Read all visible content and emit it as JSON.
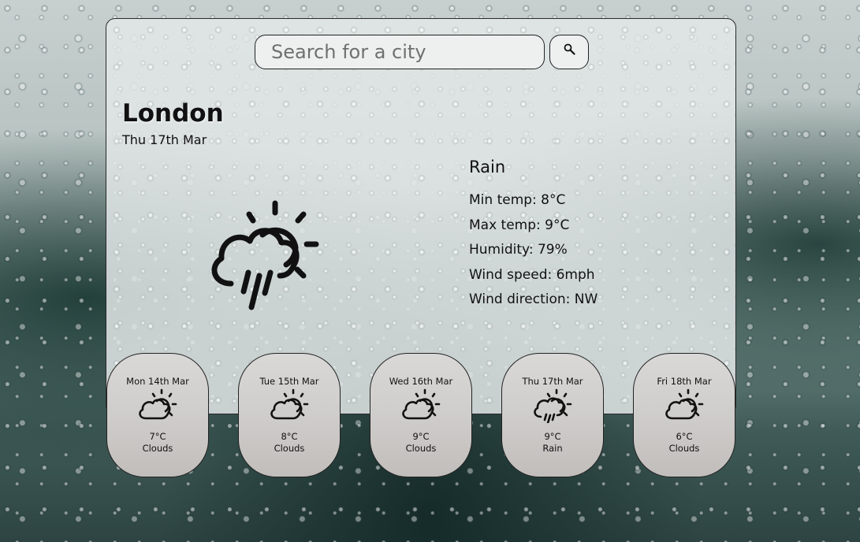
{
  "search": {
    "placeholder": "Search for a city",
    "button_icon": "search-icon"
  },
  "current": {
    "city": "London",
    "date": "Thu 17th Mar",
    "icon": "cloud-sun-rain-icon",
    "condition": "Rain",
    "min_temp": "Min temp: 8°C",
    "max_temp": "Max temp: 9°C",
    "humidity": "Humidity: 79%",
    "wind_speed": "Wind speed: 6mph",
    "wind_direction": "Wind direction: NW"
  },
  "forecast": [
    {
      "day": "Mon 14th Mar",
      "temp": "7°C",
      "desc": "Clouds",
      "icon": "cloud-sun-icon"
    },
    {
      "day": "Tue 15th Mar",
      "temp": "8°C",
      "desc": "Clouds",
      "icon": "cloud-sun-icon"
    },
    {
      "day": "Wed 16th Mar",
      "temp": "9°C",
      "desc": "Clouds",
      "icon": "cloud-sun-icon"
    },
    {
      "day": "Thu 17th Mar",
      "temp": "9°C",
      "desc": "Rain",
      "icon": "cloud-sun-rain-icon"
    },
    {
      "day": "Fri 18th Mar",
      "temp": "6°C",
      "desc": "Clouds",
      "icon": "cloud-sun-icon"
    }
  ]
}
